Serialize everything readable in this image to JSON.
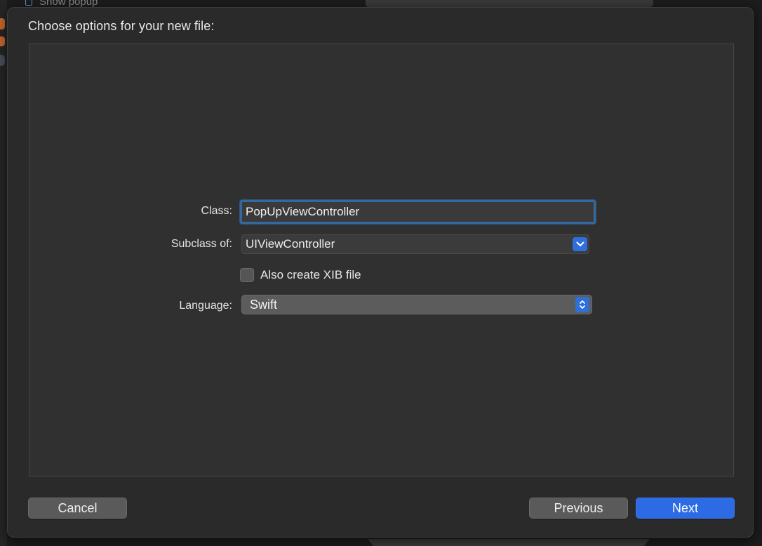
{
  "background": {
    "sidebar_row_text": "Show popup"
  },
  "sheet": {
    "title": "Choose options for your new file:"
  },
  "form": {
    "class_label": "Class:",
    "class_value": "PopUpViewController",
    "subclass_label": "Subclass of:",
    "subclass_value": "UIViewController",
    "xib_label": "Also create XIB file",
    "xib_checked": false,
    "language_label": "Language:",
    "language_value": "Swift"
  },
  "buttons": {
    "cancel": "Cancel",
    "previous": "Previous",
    "next": "Next"
  },
  "colors": {
    "accent": "#2c6be3",
    "focus_ring": "#36699b",
    "sheet_bg": "#2a2a2a",
    "panel_bg": "#303030"
  },
  "icons": {
    "combo_arrow": "chevron-down-icon",
    "popup_arrows": "up-down-chevron-icon",
    "sidebar_row": "file-icon"
  }
}
